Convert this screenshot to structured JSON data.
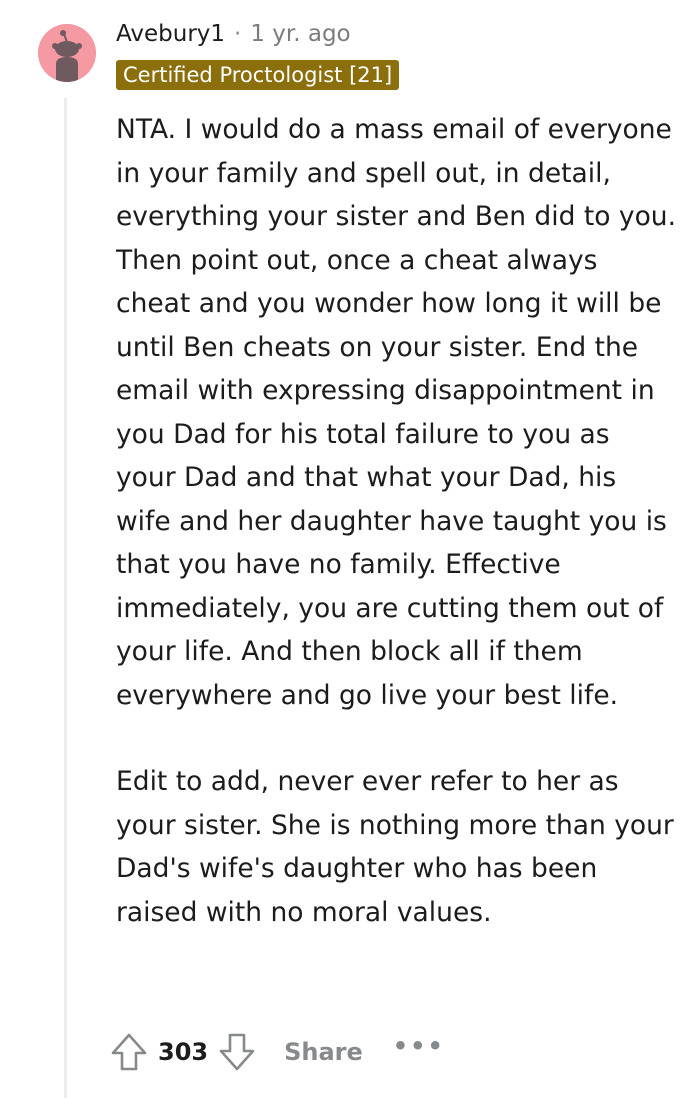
{
  "comment": {
    "username": "Avebury1",
    "separator": "·",
    "age": "1 yr. ago",
    "flair": "Certified Proctologist [21]",
    "paragraphs": [
      "NTA. I would do a mass email of everyone in your family and spell out, in detail, everything your sister and Ben did to you. Then point out, once a cheat always cheat and you wonder how long it will be until Ben cheats on your sister. End the email with expressing disappointment in you Dad for his total failure to you as your Dad and that what your Dad, his wife and her daughter have taught you is that you have no family. Effective immediately, you are cutting them out of your life. And then block all if them everywhere and go live your best life.",
      "Edit to add, never ever refer to her as your sister. She is nothing more than your Dad's wife's daughter who has been raised with no moral values."
    ]
  },
  "actions": {
    "score": "303",
    "share_label": "Share",
    "more_label": "•••"
  },
  "colors": {
    "avatar_bg": "#f59aa3",
    "flair_bg": "#8c6f0d",
    "muted": "#878a8c",
    "text": "#1c1c1c"
  },
  "icons": {
    "avatar": "snoo-avatar-icon",
    "upvote": "upvote-arrow-icon",
    "downvote": "downvote-arrow-icon",
    "more": "more-options-icon"
  }
}
